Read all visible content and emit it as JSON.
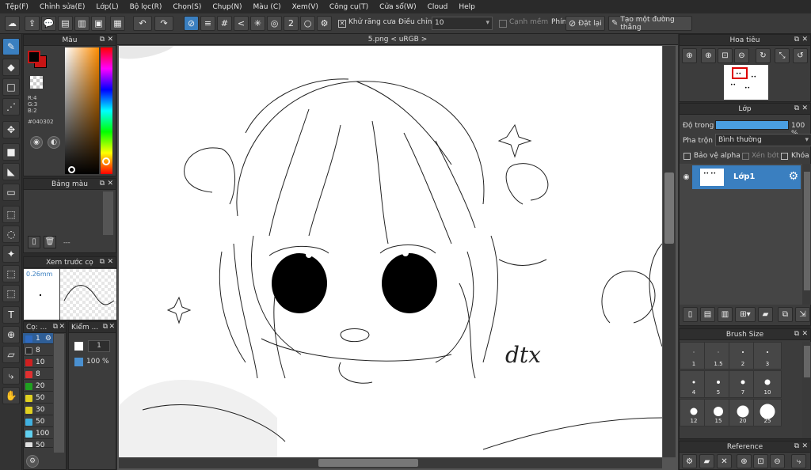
{
  "menu": [
    "Tệp(F)",
    "Chỉnh sửa(E)",
    "Lớp(L)",
    "Bộ lọc(R)",
    "Chọn(S)",
    "Chụp(N)",
    "Màu (C)",
    "Xem(V)",
    "Công cụ(T)",
    "Cửa sổ(W)",
    "Cloud",
    "Help"
  ],
  "toolbar": {
    "antialias_label": "Khử răng cưa",
    "correction_label": "Điều chỉnh",
    "correction_value": "10",
    "sharp_label": "Cạnh mềm",
    "snap_label": "Phím",
    "reset_label": "Đặt lại",
    "straight_line_label": "Tạo một đường thẳng"
  },
  "color_panel": {
    "title": "Màu",
    "r": "R:4",
    "g": "G:3",
    "b": "B:2",
    "hex": "#040302",
    "foreground": "#040302",
    "accent": "#c81414"
  },
  "palette_panel": {
    "title": "Bảng màu",
    "dashes": "---"
  },
  "brush_preview": {
    "title": "Xem trước cọ",
    "size": "0.26mm"
  },
  "brush_sizes_list": {
    "title": "Cọ: ...",
    "items": [
      {
        "size": "1",
        "color": "#3a6db0"
      },
      {
        "size": "8",
        "color": "#2a2a2a"
      },
      {
        "size": "10",
        "color": "#d02020"
      },
      {
        "size": "8",
        "color": "#e03030"
      },
      {
        "size": "20",
        "color": "#20a020"
      },
      {
        "size": "50",
        "color": "#e0d020"
      },
      {
        "size": "30",
        "color": "#e0d020"
      },
      {
        "size": "50",
        "color": "#40b0e0"
      },
      {
        "size": "100",
        "color": "#60d0f0"
      },
      {
        "size": "50",
        "color": "#e0e0e0"
      }
    ]
  },
  "checker_panel": {
    "title": "Kiểm ...",
    "value1": "1",
    "value2": "100 %"
  },
  "document": {
    "tab": "5.png < uRGB >",
    "signature": "dtx"
  },
  "navigator": {
    "title": "Hoa tiêu"
  },
  "layer_panel": {
    "title": "Lớp",
    "opacity_label": "Độ trong",
    "opacity_value": "100 %",
    "opacity": 1.0,
    "blend_label": "Pha trộn",
    "blend_value": "Bình thường",
    "protect_alpha": "Bảo vệ alpha",
    "clipping": "Xén bớt",
    "lock": "Khóa",
    "layer_name": "Lớp1"
  },
  "brush_size_panel": {
    "title": "Brush Size",
    "sizes": [
      "1",
      "1.5",
      "2",
      "3",
      "4",
      "5",
      "7",
      "10",
      "12",
      "15",
      "20",
      "25"
    ]
  },
  "reference_panel": {
    "title": "Reference"
  }
}
